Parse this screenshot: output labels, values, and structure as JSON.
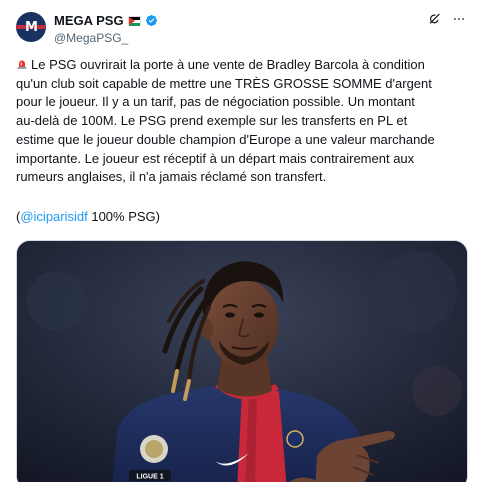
{
  "author": {
    "name": "MEGA PSG",
    "handle": "@MegaPSG_",
    "avatar_letter": "M"
  },
  "icons": {
    "avatar": "psg-logo-icon",
    "flag": "palestine-flag-icon",
    "verified": "verified-badge-icon",
    "grok": "grok-icon",
    "more": "more-options-icon",
    "siren": "rotating-light-icon"
  },
  "tweet": {
    "lines": [
      "Le PSG ouvrirait la porte à une vente de Bradley Barcola à condition",
      "qu'un club soit capable de mettre une TRÈS GROSSE SOMME d'argent",
      "pour le joueur. Il y a un tarif, pas de négociation possible. Un montant",
      "au-delà de 100M. Le PSG prend exemple sur les transferts en PL et",
      "estime que le joueur double champion d'Europe a une valeur marchande",
      "importante. Le joueur est réceptif à un départ mais contrairement aux",
      "rumeurs anglaises, il n'a jamais réclamé son transfert."
    ],
    "source_open": "(",
    "source_mention": "@iciparisidf",
    "source_rest": " 100% PSG)"
  },
  "media": {
    "sleeve_patch": "LIGUE 1",
    "colors": {
      "shirt_navy": "#1c2b5a",
      "shirt_red": "#c8283a",
      "skin": "#6b4433",
      "background": "#22283a"
    }
  },
  "colors": {
    "text": "#0f1419",
    "secondary": "#536471",
    "link": "#1d9bf0",
    "verified": "#1d9bf0"
  }
}
